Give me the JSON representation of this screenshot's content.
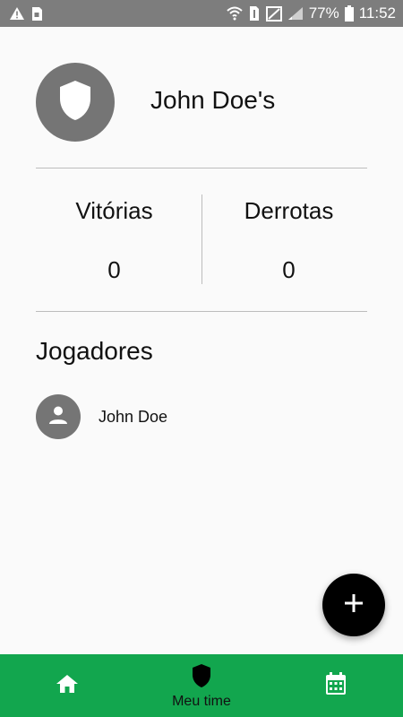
{
  "status_bar": {
    "battery_percent": "77%",
    "time": "11:52",
    "left_icons": [
      "warning-icon",
      "sim-save-icon"
    ],
    "right_icons": [
      "wifi-icon",
      "sim-1-icon",
      "no-signal-icon",
      "signal-icon",
      "battery-icon"
    ]
  },
  "team": {
    "name": "John Doe's",
    "avatar_icon": "shield-icon"
  },
  "stats": {
    "wins_label": "Vitórias",
    "wins_value": "0",
    "losses_label": "Derrotas",
    "losses_value": "0"
  },
  "players": {
    "title": "Jogadores",
    "items": [
      {
        "name": "John Doe",
        "icon": "person-icon"
      }
    ]
  },
  "fab": {
    "icon": "plus-icon"
  },
  "bottom_nav": {
    "items": [
      {
        "icon": "home-icon",
        "label": ""
      },
      {
        "icon": "shield-icon",
        "label": "Meu time",
        "active": true
      },
      {
        "icon": "calendar-icon",
        "label": ""
      }
    ]
  },
  "colors": {
    "status_bar": "#7d7d7d",
    "nav_bar": "#12a64e",
    "avatar_gray": "#757575",
    "fab": "#000000",
    "background": "#fafafa"
  }
}
